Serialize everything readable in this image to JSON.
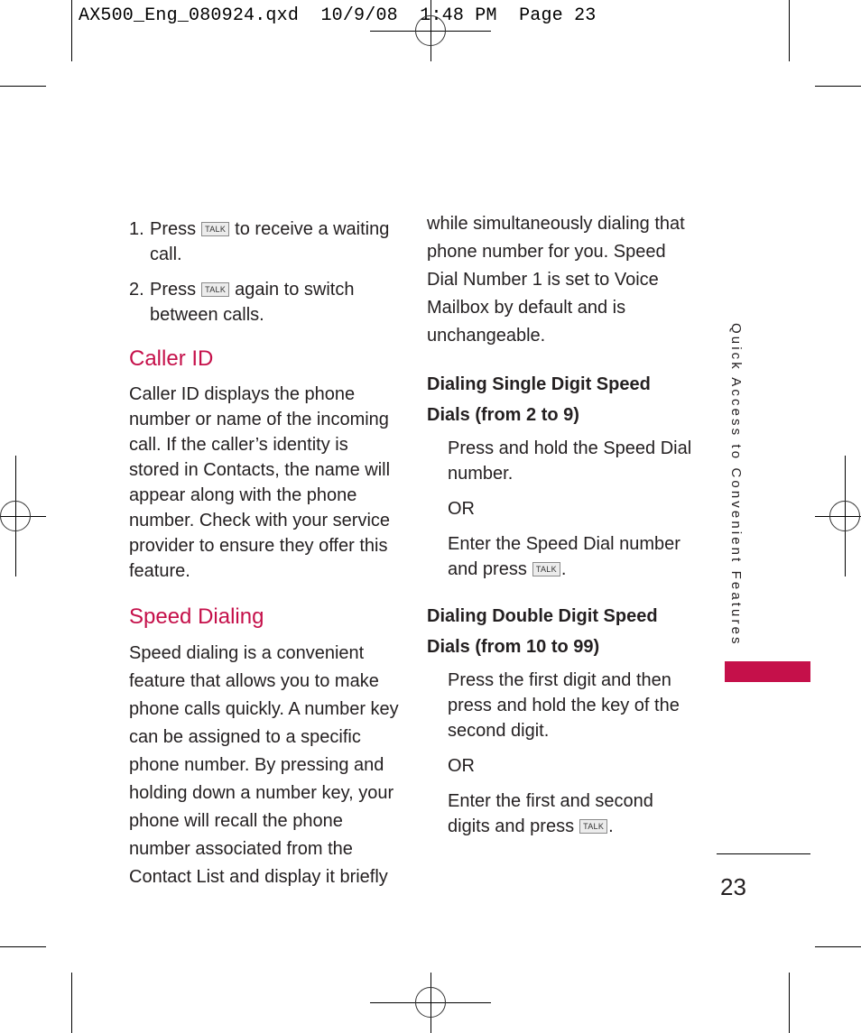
{
  "slug": {
    "text": "AX500_Eng_080924.qxd  10/9/08  1:48 PM  Page 23"
  },
  "key_label": "TALK",
  "left_column": {
    "steps": [
      {
        "num": "1.",
        "before": "Press",
        "after": "to receive a waiting call."
      },
      {
        "num": "2.",
        "before": "Press",
        "after": "again to switch between calls."
      }
    ],
    "caller_id": {
      "heading": "Caller ID",
      "body": "Caller ID displays the phone number or name of the incoming call. If the caller’s identity is stored in Contacts, the name will appear along with the phone number. Check with your service provider to ensure they offer this feature."
    },
    "speed_dialing": {
      "heading": "Speed Dialing",
      "body": "Speed dialing is a convenient feature that allows you to make phone calls quickly. A number key can be assigned to a specific phone number. By pressing and holding down a number key, your phone will recall the phone number associated from the Contact List and display it briefly"
    }
  },
  "right_column": {
    "continuation": "while simultaneously dialing that phone number for you. Speed Dial Number 1 is set to Voice Mailbox by default and is unchangeable.",
    "single_digit": {
      "heading": "Dialing Single Digit Speed Dials (from 2 to 9)",
      "option1": "Press and hold the Speed Dial number.",
      "or": "OR",
      "option2_before": "Enter the Speed Dial number and press",
      "option2_after": "."
    },
    "double_digit": {
      "heading": "Dialing Double Digit Speed Dials (from 10 to 99)",
      "option1": "Press the first digit and then press and hold the key of the second digit.",
      "or": "OR",
      "option2_before": "Enter the first and second digits and press",
      "option2_after": "."
    }
  },
  "side_tab": {
    "label": "Quick Access to Convenient Features",
    "accent_color": "#c5104a"
  },
  "page_number": "23"
}
